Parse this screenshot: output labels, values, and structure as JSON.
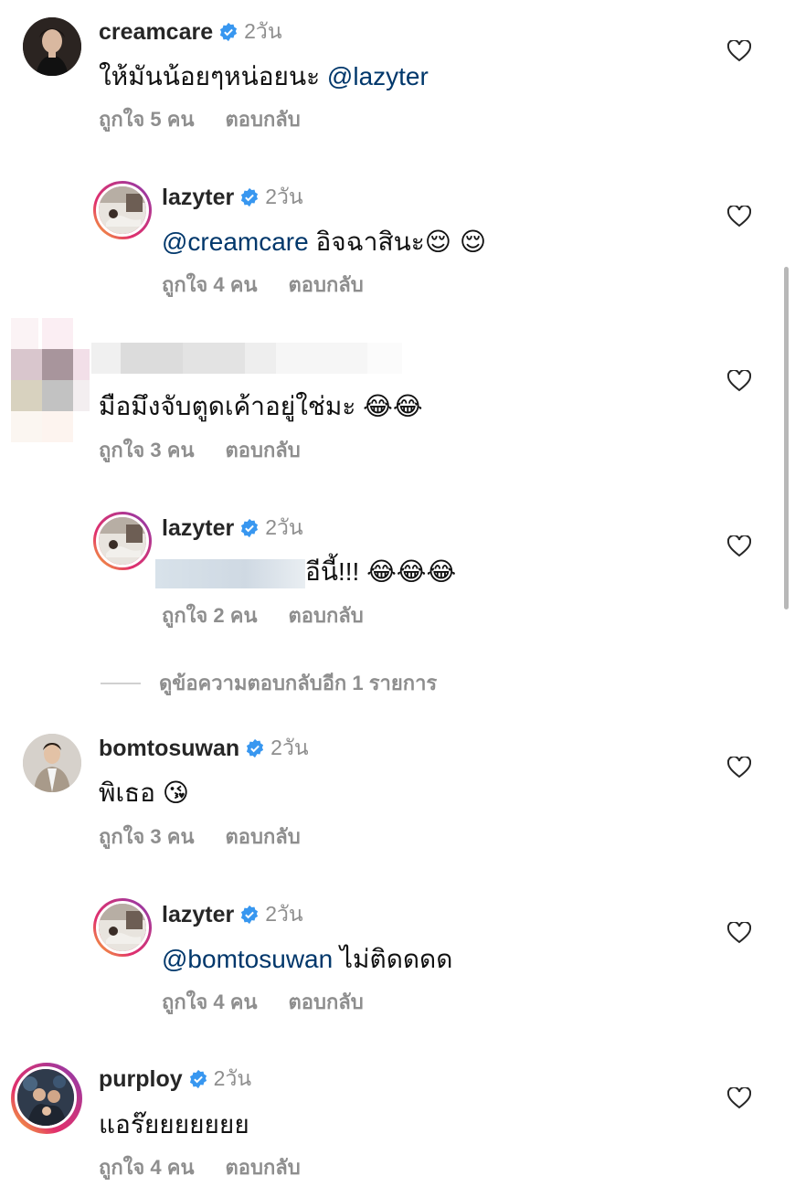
{
  "comments": [
    {
      "username": "creamcare",
      "time": "2วัน",
      "text": "ให้มันน้อยๆหน่อยนะ ",
      "mention": "@lazyter",
      "likes": "ถูกใจ 5 คน",
      "reply": "ตอบกลับ"
    },
    {
      "username": "lazyter",
      "time": "2วัน",
      "mention": "@creamcare",
      "text": " อิจฉาสินะ",
      "emojis": "😌 😌",
      "likes": "ถูกใจ 4 คน",
      "reply": "ตอบกลับ"
    },
    {
      "text": "มือมึงจับตูดเค้าอยู่ใช่มะ ",
      "emojis": "😂😂",
      "likes": "ถูกใจ 3 คน",
      "reply": "ตอบกลับ"
    },
    {
      "username": "lazyter",
      "time": "2วัน",
      "text": "อีนี้!!! ",
      "emojis": "😂😂😂",
      "likes": "ถูกใจ 2 คน",
      "reply": "ตอบกลับ"
    },
    {
      "username": "bomtosuwan",
      "time": "2วัน",
      "text": "พิเธอ ",
      "emojis": "😘",
      "likes": "ถูกใจ 3 คน",
      "reply": "ตอบกลับ"
    },
    {
      "username": "lazyter",
      "time": "2วัน",
      "mention": "@bomtosuwan",
      "text": " ไม่ติดดดด",
      "likes": "ถูกใจ 4 คน",
      "reply": "ตอบกลับ"
    },
    {
      "username": "purploy",
      "time": "2วัน",
      "text": "แอร๊ยยยยยยย",
      "likes": "ถูกใจ 4 คน",
      "reply": "ตอบกลับ"
    }
  ],
  "more_replies": "ดูข้อความตอบกลับอีก 1 รายการ",
  "icons": {
    "verified": "verified-badge-icon",
    "like": "heart-icon"
  },
  "colors": {
    "verified": "#3897f0",
    "mention": "#00376b",
    "muted": "#8e8e8e"
  }
}
